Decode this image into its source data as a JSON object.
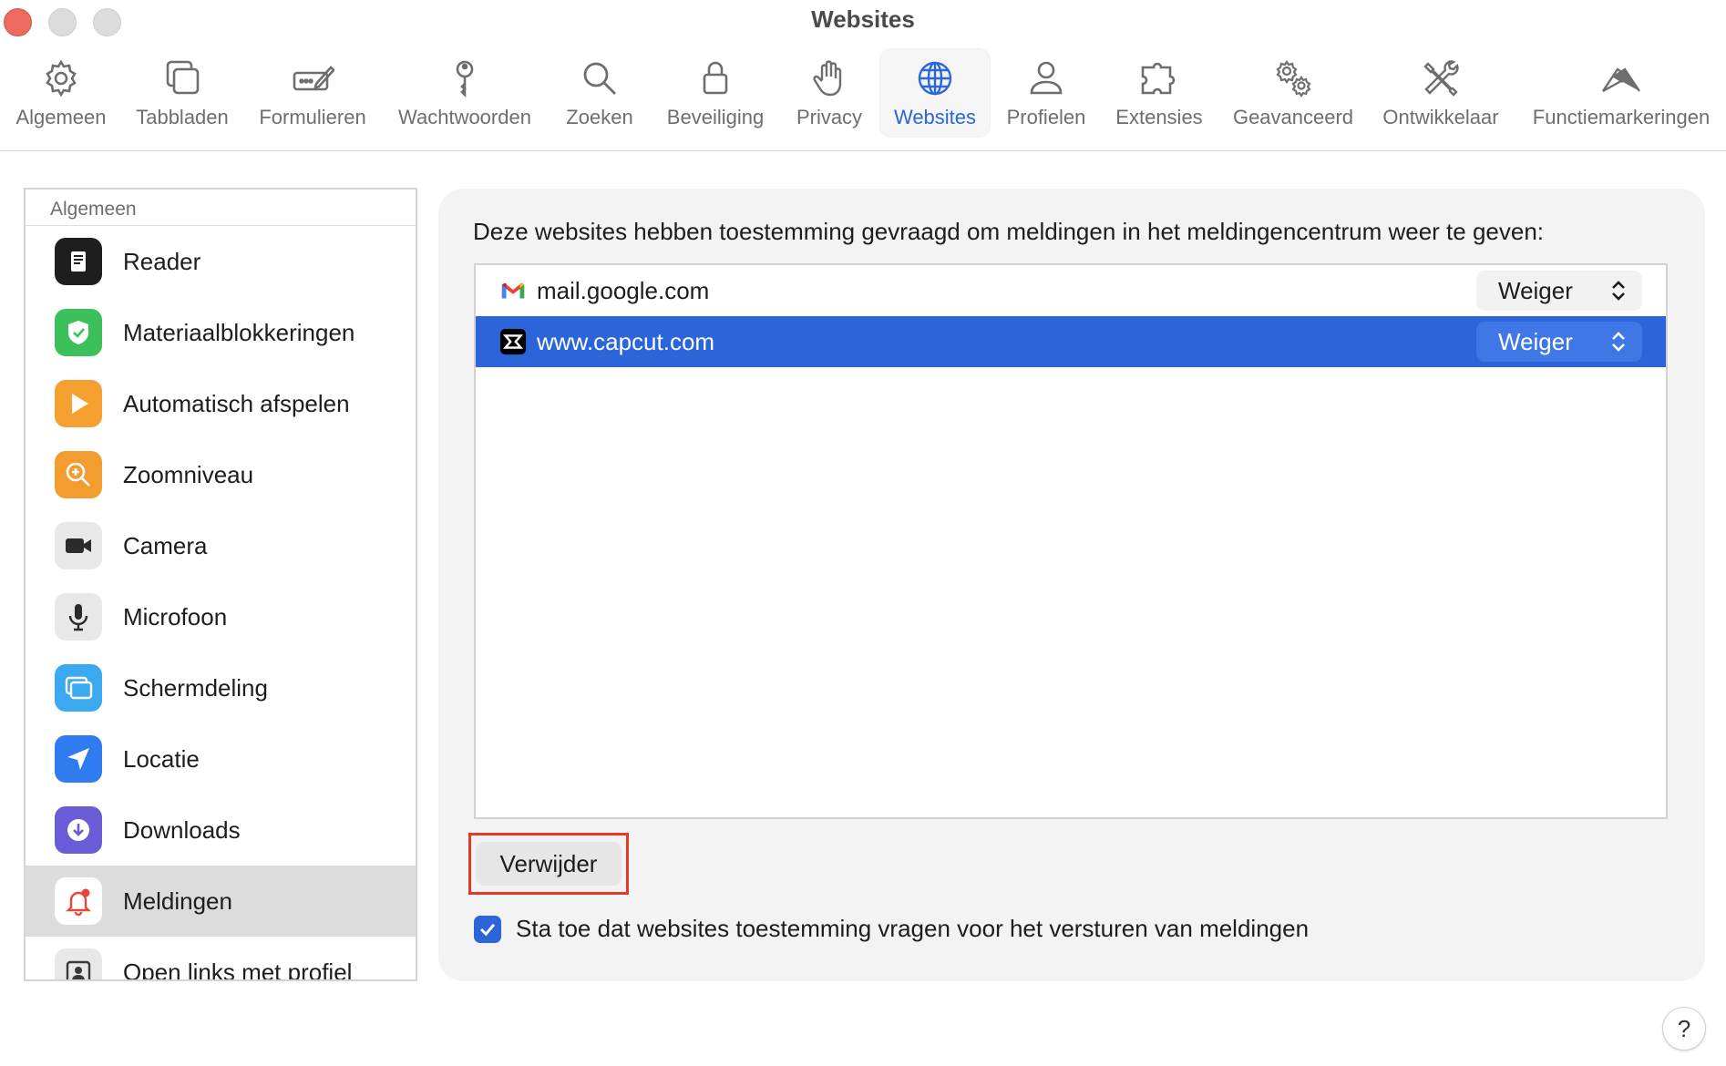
{
  "window": {
    "title": "Websites"
  },
  "toolbar": {
    "items": [
      {
        "label": "Algemeen",
        "icon": "gear-icon"
      },
      {
        "label": "Tabbladen",
        "icon": "tabs-icon"
      },
      {
        "label": "Formulieren",
        "icon": "autofill-form-icon"
      },
      {
        "label": "Wachtwoorden",
        "icon": "key-icon"
      },
      {
        "label": "Zoeken",
        "icon": "search-icon"
      },
      {
        "label": "Beveiliging",
        "icon": "lock-icon"
      },
      {
        "label": "Privacy",
        "icon": "hand-icon"
      },
      {
        "label": "Websites",
        "icon": "globe-icon",
        "active": true
      },
      {
        "label": "Profielen",
        "icon": "person-icon"
      },
      {
        "label": "Extensies",
        "icon": "puzzle-icon"
      },
      {
        "label": "Geavanceerd",
        "icon": "gears-icon"
      },
      {
        "label": "Ontwikkelaar",
        "icon": "tools-icon"
      },
      {
        "label": "Functiemarkeringen",
        "icon": "flags-icon"
      }
    ],
    "active_color": "#2a66de"
  },
  "sidebar": {
    "header": "Algemeen",
    "items": [
      {
        "label": "Reader",
        "icon": "reader-icon"
      },
      {
        "label": "Materiaalblokkeringen",
        "icon": "content-blocker-icon"
      },
      {
        "label": "Automatisch afspelen",
        "icon": "autoplay-icon"
      },
      {
        "label": "Zoomniveau",
        "icon": "zoom-icon"
      },
      {
        "label": "Camera",
        "icon": "camera-icon"
      },
      {
        "label": "Microfoon",
        "icon": "microphone-icon"
      },
      {
        "label": "Schermdeling",
        "icon": "screen-sharing-icon"
      },
      {
        "label": "Locatie",
        "icon": "location-icon"
      },
      {
        "label": "Downloads",
        "icon": "downloads-icon"
      },
      {
        "label": "Meldingen",
        "icon": "notifications-icon",
        "selected": true
      },
      {
        "label": "Open links met profiel",
        "icon": "profile-links-icon"
      }
    ]
  },
  "main": {
    "intro": "Deze websites hebben toestemming gevraagd om meldingen in het meldingencentrum weer te geven:",
    "sites": [
      {
        "domain": "mail.google.com",
        "setting": "Weiger",
        "icon": "gmail-icon"
      },
      {
        "domain": "www.capcut.com",
        "setting": "Weiger",
        "icon": "capcut-icon",
        "selected": true
      }
    ],
    "remove_label": "Verwijder",
    "allow_label": "Sta toe dat websites toestemming vragen voor het versturen van meldingen",
    "allow_checked": true,
    "selection_color": "#2c64d9"
  },
  "help": {
    "label": "?"
  }
}
